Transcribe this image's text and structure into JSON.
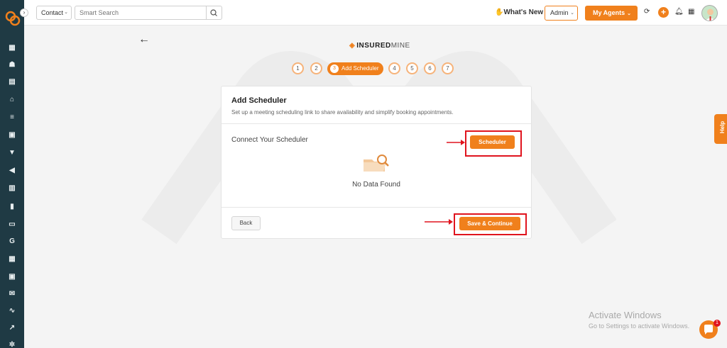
{
  "sidebar": {
    "logo_icon": "insuredmine-logo-icon",
    "collapse": "›",
    "items": [
      {
        "name": "dashboard-icon",
        "glyph": "▦"
      },
      {
        "name": "contacts-icon",
        "glyph": "☗"
      },
      {
        "name": "documents-icon",
        "glyph": "▤"
      },
      {
        "name": "institution-icon",
        "glyph": "⌂"
      },
      {
        "name": "list-icon",
        "glyph": "≡"
      },
      {
        "name": "contact-card-icon",
        "glyph": "▣"
      },
      {
        "name": "funnel-icon",
        "glyph": "▼"
      },
      {
        "name": "megaphone-icon",
        "glyph": "◀"
      },
      {
        "name": "clipboard-icon",
        "glyph": "▥"
      },
      {
        "name": "bar-chart-icon",
        "glyph": "▮"
      },
      {
        "name": "folder-icon",
        "glyph": "▭"
      },
      {
        "name": "google-icon",
        "glyph": "G"
      },
      {
        "name": "table-icon",
        "glyph": "▦"
      },
      {
        "name": "calendar-icon",
        "glyph": "▣"
      },
      {
        "name": "mail-icon",
        "glyph": "✉"
      },
      {
        "name": "signature-icon",
        "glyph": "∿"
      },
      {
        "name": "line-chart-icon",
        "glyph": "↗"
      },
      {
        "name": "settings-icon",
        "glyph": "✲"
      }
    ]
  },
  "topbar": {
    "contact_select": "Contact",
    "search_placeholder": "Smart Search",
    "whats_new": "What's New",
    "admin_select": "Admin",
    "agents_button": "My Agents",
    "chevron": "⌄",
    "plus": "+"
  },
  "wizard": {
    "brand_main": "INSURED",
    "brand_sub": "MINE",
    "steps": [
      "1",
      "2",
      "3",
      "4",
      "5",
      "6",
      "7"
    ],
    "active_step_num": "3",
    "active_step_label": "Add Scheduler"
  },
  "card": {
    "title": "Add Scheduler",
    "subtitle": "Set up a meeting scheduling link to share availability and simplify booking appointments.",
    "connect_label": "Connect Your Scheduler",
    "scheduler_button": "Scheduler",
    "empty_text": "No Data Found",
    "back_button": "Back",
    "save_button": "Save & Continue"
  },
  "help_label": "Help",
  "watermark": {
    "line1": "Activate Windows",
    "line2": "Go to Settings to activate Windows."
  },
  "chat_badge": "1",
  "colors": {
    "accent": "#f0801c",
    "sidebar": "#1f3a44",
    "highlight": "#e0141e"
  }
}
